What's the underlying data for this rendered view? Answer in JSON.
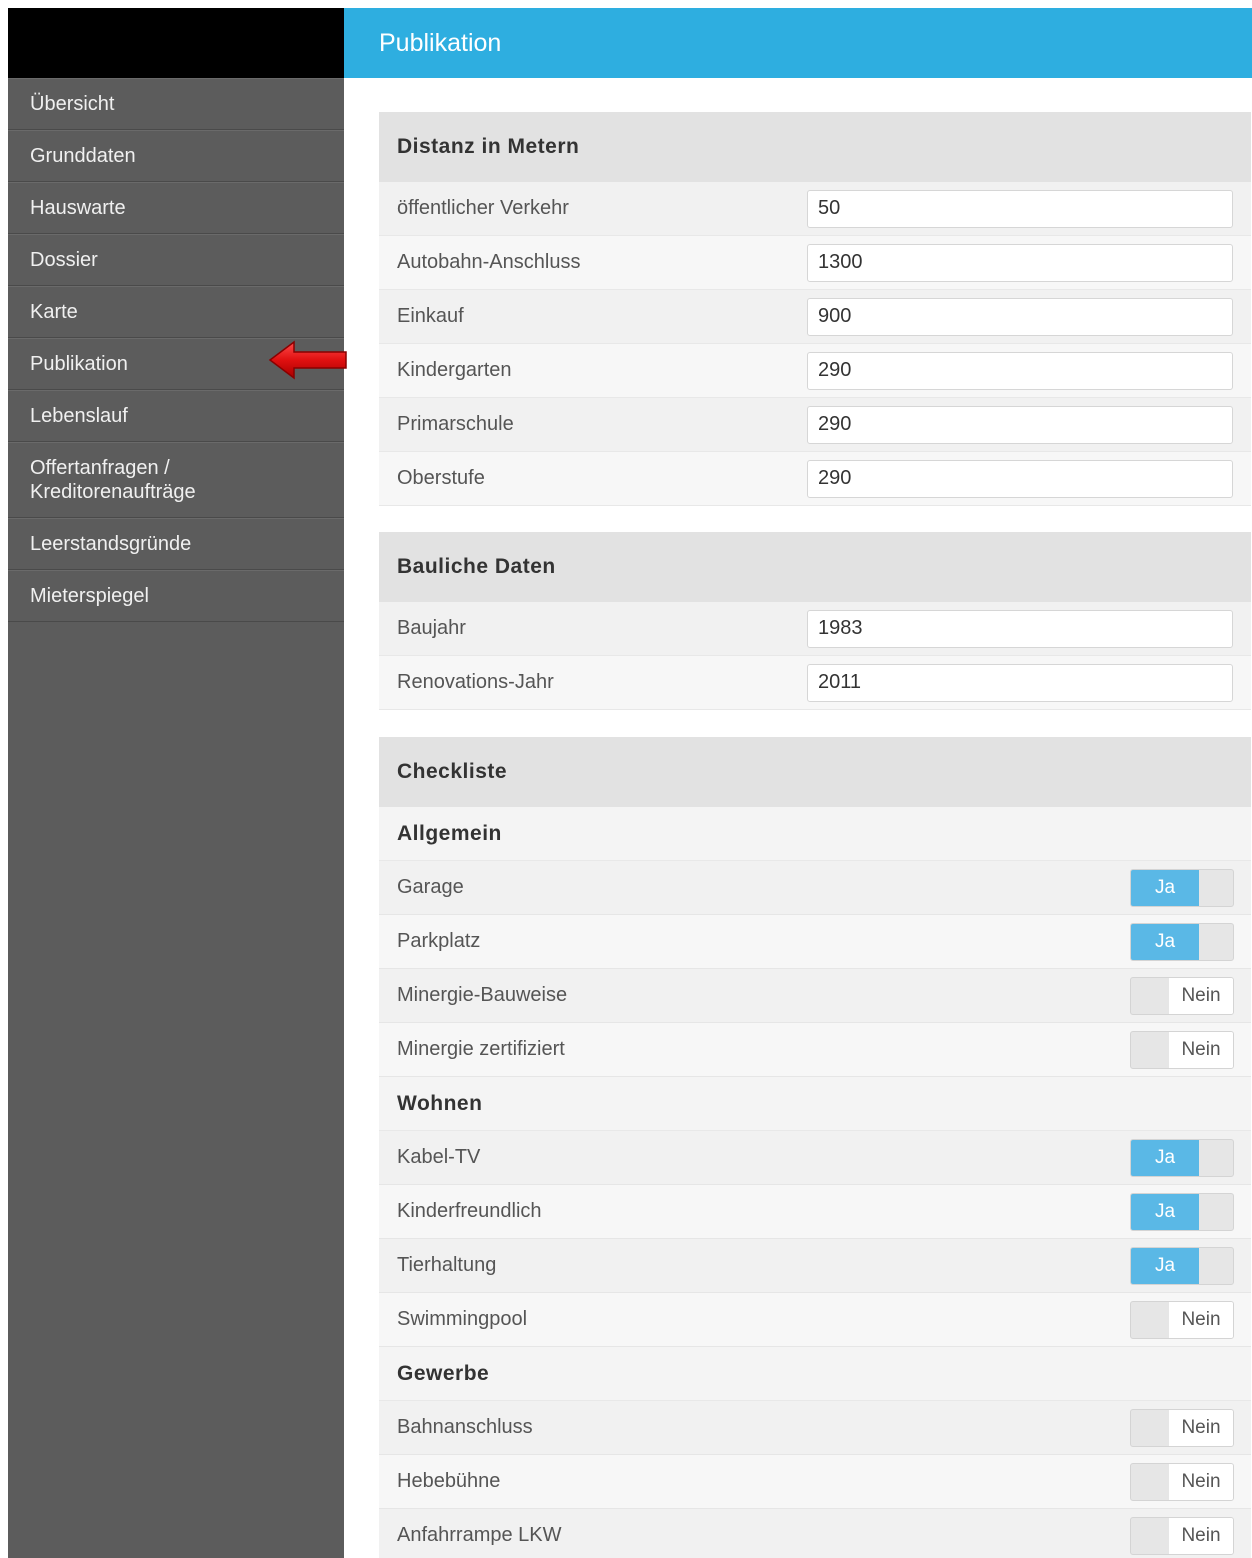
{
  "sidebar": {
    "items": [
      {
        "label": "Übersicht"
      },
      {
        "label": "Grunddaten"
      },
      {
        "label": "Hauswarte"
      },
      {
        "label": "Dossier"
      },
      {
        "label": "Karte"
      },
      {
        "label": "Publikation"
      },
      {
        "label": "Lebenslauf"
      },
      {
        "label": "Offertanfragen / Kreditorenaufträge"
      },
      {
        "label": "Leerstandsgründe"
      },
      {
        "label": "Mieterspiegel"
      }
    ],
    "arrow_color": "#e01010"
  },
  "header": {
    "title": "Publikation",
    "color": "#2eaee0"
  },
  "distanz": {
    "title": "Distanz in Metern",
    "rows": [
      {
        "label": "öffentlicher Verkehr",
        "value": "50"
      },
      {
        "label": "Autobahn-Anschluss",
        "value": "1300"
      },
      {
        "label": "Einkauf",
        "value": "900"
      },
      {
        "label": "Kindergarten",
        "value": "290"
      },
      {
        "label": "Primarschule",
        "value": "290"
      },
      {
        "label": "Oberstufe",
        "value": "290"
      }
    ]
  },
  "bauliche": {
    "title": "Bauliche Daten",
    "rows": [
      {
        "label": "Baujahr",
        "value": "1983"
      },
      {
        "label": "Renovations-Jahr",
        "value": "2011"
      }
    ]
  },
  "checkliste": {
    "title": "Checkliste",
    "yes_label": "Ja",
    "no_label": "Nein",
    "groups": [
      {
        "title": "Allgemein",
        "items": [
          {
            "label": "Garage",
            "state": "Ja"
          },
          {
            "label": "Parkplatz",
            "state": "Ja"
          },
          {
            "label": "Minergie-Bauweise",
            "state": "Nein"
          },
          {
            "label": "Minergie zertifiziert",
            "state": "Nein"
          }
        ]
      },
      {
        "title": "Wohnen",
        "items": [
          {
            "label": "Kabel-TV",
            "state": "Ja"
          },
          {
            "label": "Kinderfreundlich",
            "state": "Ja"
          },
          {
            "label": "Tierhaltung",
            "state": "Ja"
          },
          {
            "label": "Swimmingpool",
            "state": "Nein"
          }
        ]
      },
      {
        "title": "Gewerbe",
        "items": [
          {
            "label": "Bahnanschluss",
            "state": "Nein"
          },
          {
            "label": "Hebebühne",
            "state": "Nein"
          },
          {
            "label": "Anfahrrampe LKW",
            "state": "Nein"
          }
        ]
      }
    ]
  }
}
